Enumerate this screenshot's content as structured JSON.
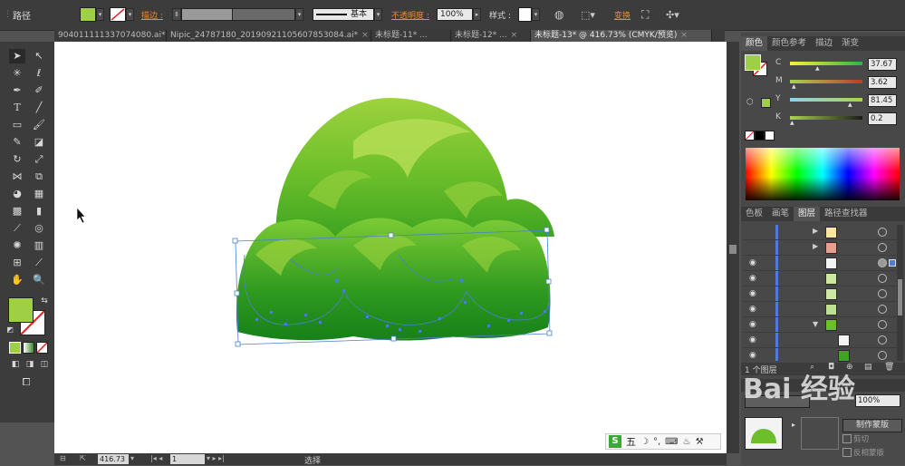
{
  "control_bar": {
    "object_type": "路径",
    "stroke_label": "描边 :",
    "stroke_style": "基本",
    "opacity_label": "不透明度 :",
    "opacity_value": "100%",
    "style_label": "样式 :",
    "transform_label": "变换",
    "fill_color": "#9fcf45"
  },
  "tabs": [
    {
      "label": "9040111113370740​80.ai*",
      "close": "×"
    },
    {
      "label": "Nipic_24787180_20190921105607853084.ai*",
      "close": "×"
    },
    {
      "label": "未标题-11* ...",
      "close": ""
    },
    {
      "label": "未标题-12* ...",
      "close": "×"
    },
    {
      "label": "未标题-13* @ 416.73% (CMYK/预览)",
      "close": "×"
    }
  ],
  "statusbar": {
    "zoom": "416.73",
    "page": "1",
    "mode": "选择"
  },
  "color_panel": {
    "tabs": [
      "颜色",
      "颜色参考",
      "描边",
      "渐变"
    ],
    "channels": [
      {
        "name": "C",
        "value": "37.67"
      },
      {
        "name": "M",
        "value": "3.62"
      },
      {
        "name": "Y",
        "value": "81.45"
      },
      {
        "name": "K",
        "value": "0.2"
      }
    ]
  },
  "layers_panel": {
    "tabs": [
      "色板",
      "画笔",
      "图层",
      "路径查找器"
    ],
    "footer": "1 个图层"
  },
  "transparency_panel": {
    "value": "100%",
    "make_mask": "制作蒙版",
    "clip": "剪切",
    "invert": "反相蒙版"
  },
  "ime_bar": {
    "label": "五"
  },
  "watermark": "Bai 经验"
}
